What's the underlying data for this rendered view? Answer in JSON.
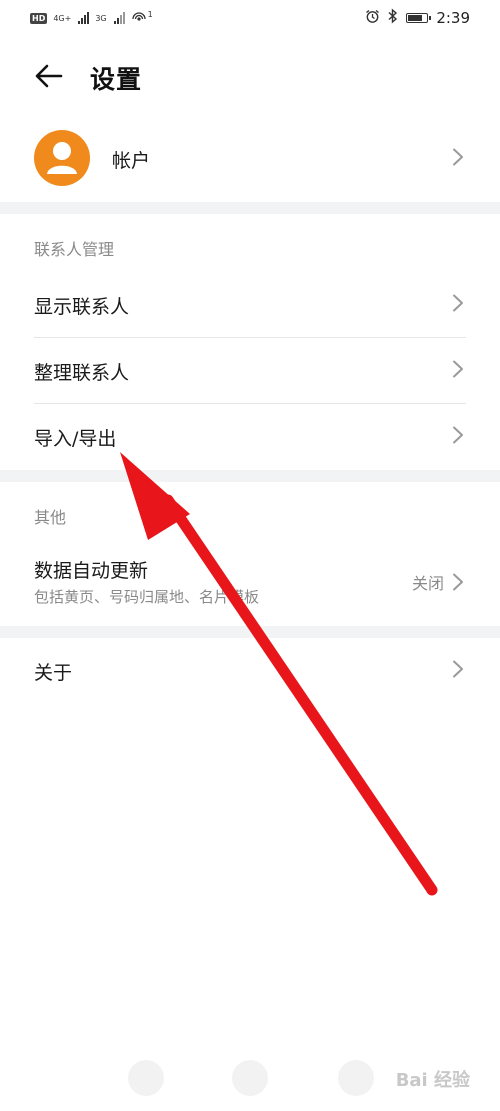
{
  "status_bar": {
    "left": {
      "hd": "HD",
      "net1": "4G+",
      "net2": "3G",
      "hotspot_badge": "1"
    },
    "battery_level_pct": 80,
    "time": "2:39"
  },
  "header": {
    "title": "设置"
  },
  "account": {
    "label": "帐户"
  },
  "sections": {
    "contacts": {
      "title": "联系人管理",
      "items": [
        {
          "label": "显示联系人"
        },
        {
          "label": "整理联系人"
        },
        {
          "label": "导入/导出"
        }
      ]
    },
    "other": {
      "title": "其他",
      "auto_update": {
        "label": "数据自动更新",
        "subtitle": "包括黄页、号码归属地、名片模板",
        "value": "关闭"
      }
    },
    "about": {
      "label": "关于"
    }
  },
  "watermark": {
    "text": "Bai 经验"
  },
  "colors": {
    "accent": "#f08a1c",
    "annotation_arrow": "#e8161a",
    "divider_band": "#f1f3f5"
  }
}
